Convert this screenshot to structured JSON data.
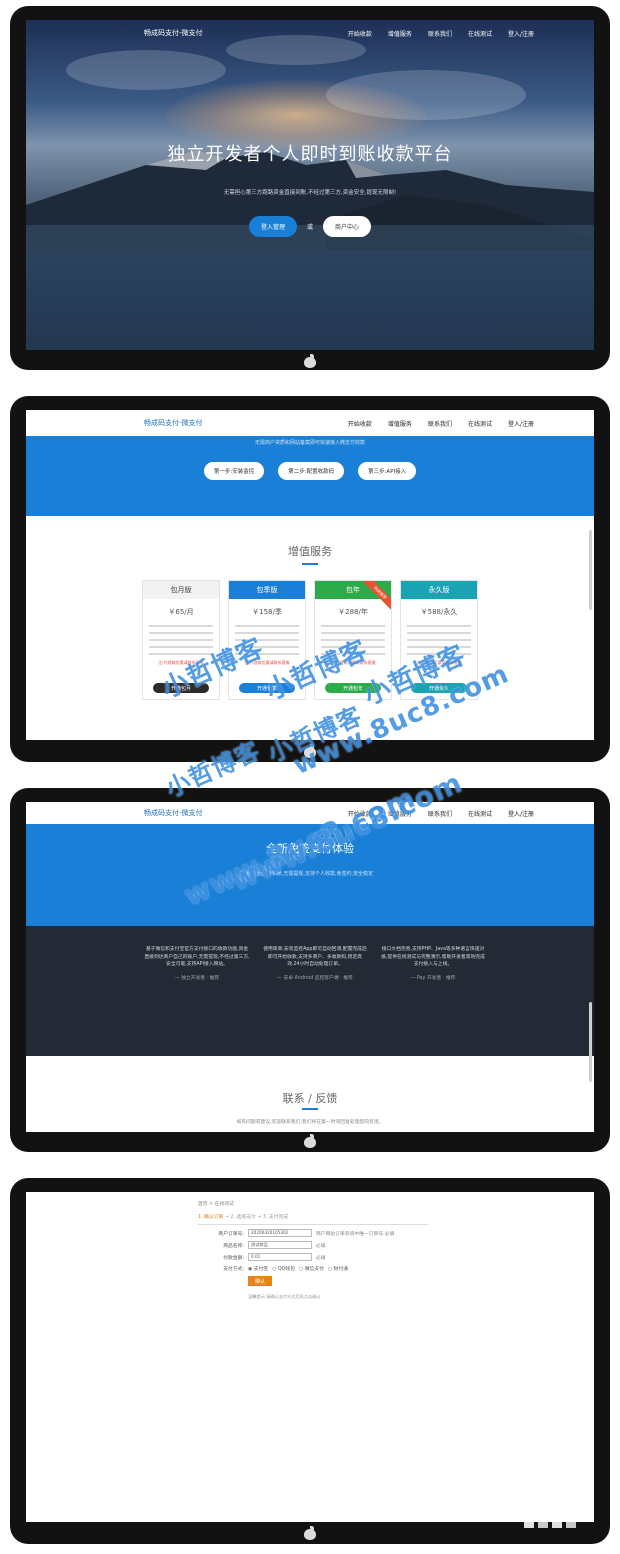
{
  "site": {
    "brand": "畅成码支付-微支付",
    "nav": [
      "开始收款",
      "增值服务",
      "联系我们",
      "在线测试",
      "登入/注册"
    ]
  },
  "hero": {
    "title": "独立开发者个人即时到账收款平台",
    "subtitle": "无需担心第三方跑路资金直接到账,不经过第三方,资金安全,提现无限制!",
    "primary_button": "登入管理",
    "or_text": "或",
    "secondary_button": "商户中心"
  },
  "setup": {
    "note": "无需商户资质和网站备案即可快速接入微支付收款",
    "steps": [
      "第一步:安装监控",
      "第二步:配置收款码",
      "第三步:API接入"
    ]
  },
  "services": {
    "title": "增值服务",
    "plans": [
      {
        "name": "包月版",
        "price": "￥65/月",
        "button": "开通包月",
        "color": "#f2f2f2",
        "text_color": "#444",
        "btn_color": "#2b2b2b"
      },
      {
        "name": "包季版",
        "price": "￥158/季",
        "button": "开通包季",
        "color": "#1a7fd6",
        "text_color": "#ffffff",
        "btn_color": "#1a7fd6"
      },
      {
        "name": "包年",
        "price": "￥288/年",
        "button": "开通包年",
        "color": "#2daa4a",
        "text_color": "#ffffff",
        "btn_color": "#2daa4a",
        "ribbon": "热卖推荐"
      },
      {
        "name": "永久版",
        "price": "￥588/永久",
        "button": "开通永久",
        "color": "#1aa3b3",
        "text_color": "#ffffff",
        "btn_color": "#1aa3b3"
      }
    ],
    "warn": "注:代理商优惠请联系客服"
  },
  "features": {
    "title": "全新免签支付体验",
    "subtitle": "付款后直接到账,无需提现,支持个人收款,免签约,安全稳定"
  },
  "quotes": [
    {
      "text": "基于微信和支付宝官方支付接口的收款功能,资金直接到达商户自己的账户,无需提现,不经过第三方,安全可靠,支持API接入网站。",
      "author": "— 独立开发者 · 推荐"
    },
    {
      "text": "使用简单,安装监控App即可自动回调,配置完成后即可开始收款,支持多商户、多收款码,稳定高效,24小时自动处理订单。",
      "author": "— 安卓 Android 监控客户端 · 推荐"
    },
    {
      "text": "接口文档完善,支持PHP、Java等多种语言快速对接,提供在线测试与完整演示,帮助开发者高效完成支付接入与上线。",
      "author": "— Pay 开发者 · 推荐"
    }
  ],
  "contact": {
    "title": "联系 / 反馈",
    "line": "如有问题或建议,欢迎联系我们,我们将在第一时间回复处理您的反馈。"
  },
  "test_form": {
    "breadcrumb": "首页 > 在线测试",
    "steps": [
      "1. 确认订单",
      "2. 选择支付",
      "3. 支付完成"
    ],
    "fields": [
      {
        "label": "商户订单号:",
        "value": "20200420105302",
        "hint": "商户网站订单系统中唯一订单号,必填"
      },
      {
        "label": "商品名称:",
        "value": "测试商品",
        "hint": "必填"
      },
      {
        "label": "付款金额:",
        "value": "0.01",
        "hint": "必填"
      }
    ],
    "pay_label": "支付方式:",
    "pay_methods": [
      "支付宝",
      "QQ钱包",
      "微信支付",
      "财付通"
    ],
    "confirm": "确认",
    "tip": "温馨提示:请确认支付方式后再点击确认"
  },
  "watermark": {
    "line1": "小哲博客",
    "line2": "www.8uc8.com"
  }
}
